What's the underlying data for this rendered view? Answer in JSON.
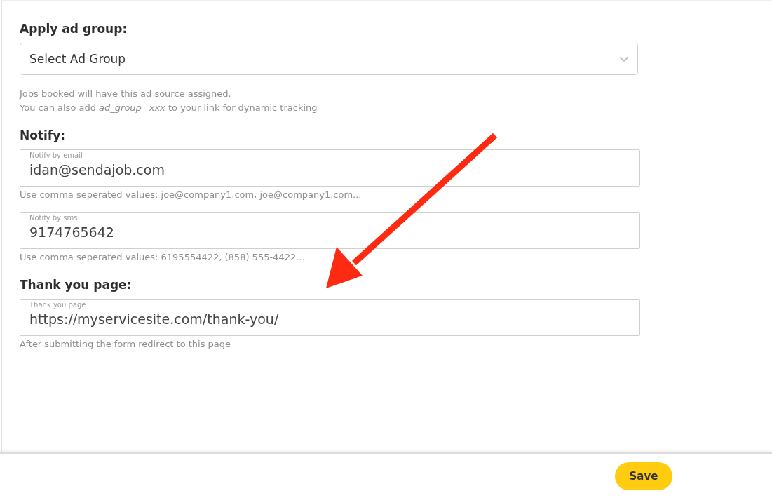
{
  "ad_group": {
    "heading": "Apply ad group:",
    "select": {
      "placeholder": "Select Ad Group"
    },
    "hints": [
      "Jobs booked will have this ad source assigned.",
      "You can also add *ad_group=xxx* to your link for dynamic tracking"
    ]
  },
  "notify": {
    "heading": "Notify:",
    "fields": [
      {
        "label": "Notify by email",
        "value": "idan@sendajob.com",
        "hint": "Use comma seperated values: joe@company1.com, joe@company1.com..."
      },
      {
        "label": "Notify by sms",
        "value": "9174765642",
        "hint": "Use comma seperated values: 6195554422, (858) 555-4422..."
      }
    ]
  },
  "thank_you": {
    "heading": "Thank you page:",
    "field": {
      "label": "Thank you page",
      "value": "https://myservicesite.com/thank-you/",
      "hint": "After submitting the form redirect to this page"
    }
  },
  "footer": {
    "save_button": "Save"
  }
}
